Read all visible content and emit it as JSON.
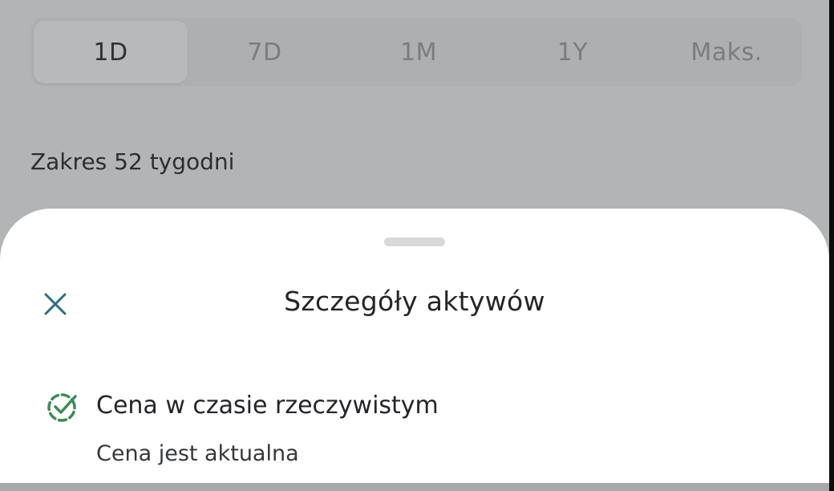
{
  "range_tabs": [
    {
      "label": "1D",
      "active": true
    },
    {
      "label": "7D",
      "active": false
    },
    {
      "label": "1M",
      "active": false
    },
    {
      "label": "1Y",
      "active": false
    },
    {
      "label": "Maks.",
      "active": false
    }
  ],
  "week_range_label": "Zakres 52 tygodni",
  "sheet": {
    "title": "Szczegóły aktywów",
    "close_icon": "close-icon",
    "status": {
      "icon": "check-circle-dashed-icon",
      "title": "Cena w czasie rzeczywistym",
      "subtitle": "Cena jest aktualna"
    }
  },
  "colors": {
    "accent": "#2e6f80",
    "success": "#3f8a55",
    "scrim_bg": "#b3b4b6",
    "sheet_bg": "#ffffff"
  }
}
